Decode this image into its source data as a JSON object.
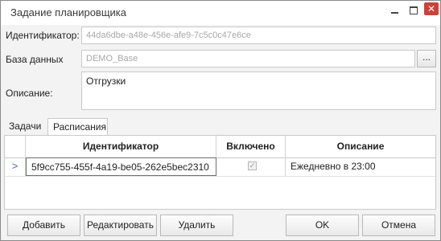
{
  "window": {
    "title": "Задание планировщика"
  },
  "form": {
    "identifier_label": "Идентификатор:",
    "identifier_value": "44da6dbe-a48e-456e-afe9-7c5c0c47e6ce",
    "database_label": "База данных",
    "database_value": "DEMO_Base",
    "database_browse": "...",
    "description_label": "Описание:",
    "description_value": "Отгрузки"
  },
  "tabs": [
    {
      "label": "Задачи",
      "active": false
    },
    {
      "label": "Расписания",
      "active": true
    }
  ],
  "grid": {
    "columns": [
      "Идентификатор",
      "Включено",
      "Описание"
    ],
    "rows": [
      {
        "id": "5f9cc755-455f-4a19-be05-262e5bec2310",
        "enabled": true,
        "description": "Ежедневно в 23:00"
      }
    ]
  },
  "buttons": {
    "add": "Добавить",
    "edit": "Редактировать",
    "delete": "Удалить",
    "ok": "OK",
    "cancel": "Отмена"
  }
}
